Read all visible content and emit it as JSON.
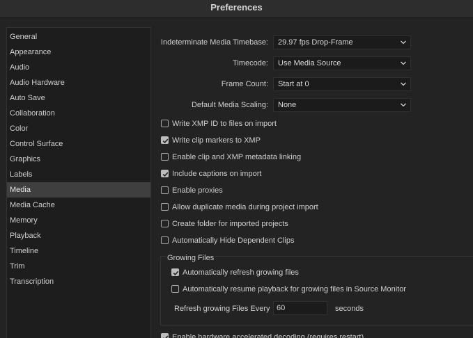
{
  "window": {
    "title": "Preferences"
  },
  "sidebar": {
    "items": [
      {
        "label": "General",
        "selected": false
      },
      {
        "label": "Appearance",
        "selected": false
      },
      {
        "label": "Audio",
        "selected": false
      },
      {
        "label": "Audio Hardware",
        "selected": false
      },
      {
        "label": "Auto Save",
        "selected": false
      },
      {
        "label": "Collaboration",
        "selected": false
      },
      {
        "label": "Color",
        "selected": false
      },
      {
        "label": "Control Surface",
        "selected": false
      },
      {
        "label": "Graphics",
        "selected": false
      },
      {
        "label": "Labels",
        "selected": false
      },
      {
        "label": "Media",
        "selected": true
      },
      {
        "label": "Media Cache",
        "selected": false
      },
      {
        "label": "Memory",
        "selected": false
      },
      {
        "label": "Playback",
        "selected": false
      },
      {
        "label": "Timeline",
        "selected": false
      },
      {
        "label": "Trim",
        "selected": false
      },
      {
        "label": "Transcription",
        "selected": false
      }
    ]
  },
  "media": {
    "dropdowns": [
      {
        "label": "Indeterminate Media Timebase:",
        "value": "29.97 fps Drop-Frame"
      },
      {
        "label": "Timecode:",
        "value": "Use Media Source"
      },
      {
        "label": "Frame Count:",
        "value": "Start at 0"
      },
      {
        "label": "Default Media Scaling:",
        "value": "None"
      }
    ],
    "checkboxes": [
      {
        "label": "Write XMP ID to files on import",
        "checked": false
      },
      {
        "label": "Write clip markers to XMP",
        "checked": true
      },
      {
        "label": "Enable clip and XMP metadata linking",
        "checked": false
      },
      {
        "label": "Include captions on import",
        "checked": true
      },
      {
        "label": "Enable proxies",
        "checked": false
      },
      {
        "label": "Allow duplicate media during project import",
        "checked": false
      },
      {
        "label": "Create folder for imported projects",
        "checked": false
      },
      {
        "label": "Automatically Hide Dependent Clips",
        "checked": false
      }
    ],
    "growing_files": {
      "title": "Growing Files",
      "checkboxes": [
        {
          "label": "Automatically refresh growing files",
          "checked": true
        },
        {
          "label": "Automatically resume playback for growing files in Source Monitor",
          "checked": false
        }
      ],
      "refresh_label": "Refresh growing Files Every",
      "refresh_value": "60",
      "seconds_label": "seconds"
    },
    "bottom_checkbox": {
      "label": "Enable hardware accelerated decoding (requires restart)",
      "checked": true
    }
  },
  "colors": {
    "background": "#232323",
    "sidebar_bg": "#1d1d1d",
    "selected_bg": "#3f3f3f",
    "text": "#cfcfcf"
  }
}
